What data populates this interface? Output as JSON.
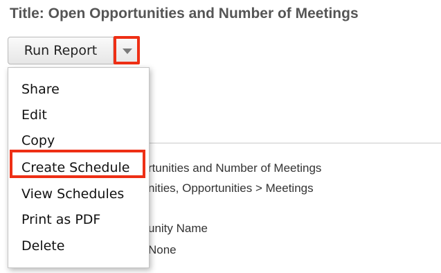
{
  "page": {
    "title": "Title: Open Opportunities and Number of Meetings"
  },
  "toolbar": {
    "run_report_label": "Run Report",
    "dropdown_icon": "caret-down-icon"
  },
  "dropdown_menu": {
    "items": [
      {
        "label": "Share"
      },
      {
        "label": "Edit"
      },
      {
        "label": "Copy"
      },
      {
        "label": "Create Schedule"
      },
      {
        "label": "View Schedules"
      },
      {
        "label": "Print as PDF"
      },
      {
        "label": "Delete"
      }
    ]
  },
  "background_details": {
    "report_name_partial": "rtunities and Number of Meetings",
    "modules_partial": "nities, Opportunities > Meetings",
    "field_partial": "unity Name",
    "value_partial": "None"
  },
  "highlight_color": "#ee2f15"
}
